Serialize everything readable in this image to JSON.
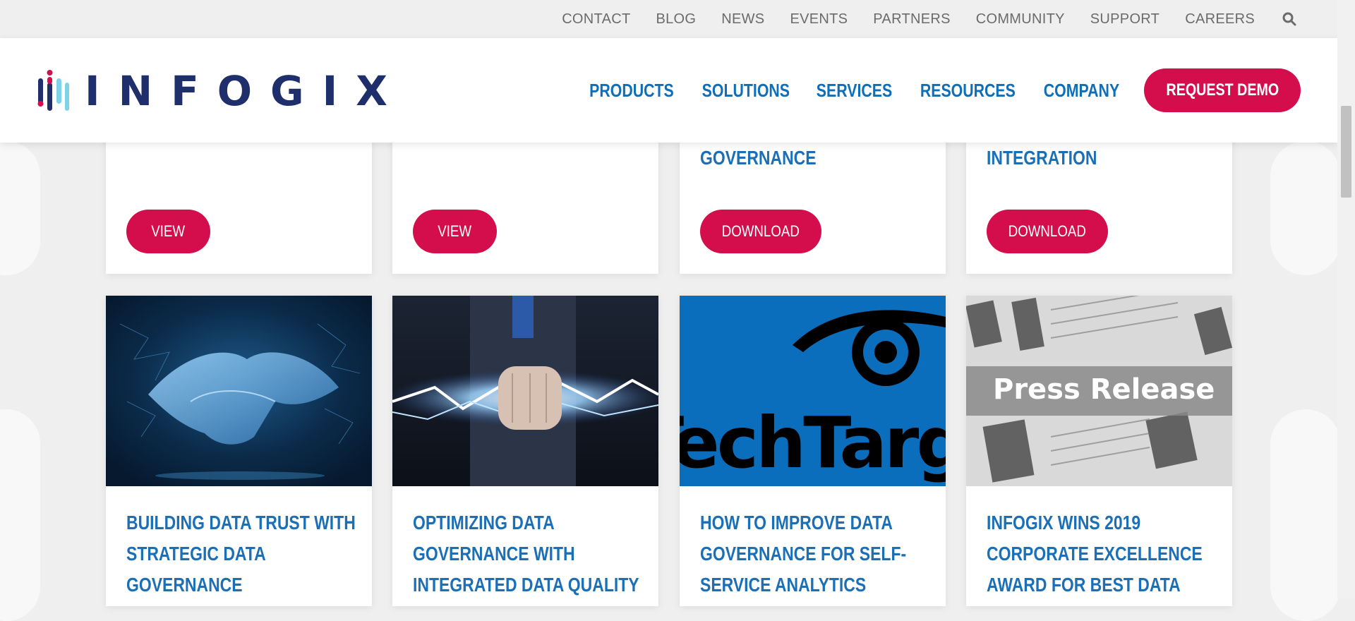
{
  "topbar": {
    "links": [
      "CONTACT",
      "BLOG",
      "NEWS",
      "EVENTS",
      "PARTNERS",
      "COMMUNITY",
      "SUPPORT",
      "CAREERS"
    ],
    "search_icon": "search-icon"
  },
  "header": {
    "logo_text": "INFOGIX",
    "nav": [
      "PRODUCTS",
      "SOLUTIONS",
      "SERVICES",
      "RESOURCES",
      "COMPANY"
    ],
    "cta_label": "REQUEST DEMO"
  },
  "colors": {
    "brand_blue": "#1a6fb7",
    "brand_navy": "#1f2f6b",
    "accent_red": "#d40e4d",
    "logo_cyan": "#7fd3e8"
  },
  "cards_top": [
    {
      "title": "",
      "button": "VIEW"
    },
    {
      "title": "",
      "button": "VIEW"
    },
    {
      "title": "GOVERNANCE",
      "button": "DOWNLOAD"
    },
    {
      "title": "INTEGRATION",
      "button": "DOWNLOAD"
    }
  ],
  "cards_bottom": [
    {
      "image": "handshake-image",
      "title_lines": [
        "BUILDING DATA TRUST WITH",
        "STRATEGIC DATA",
        "GOVERNANCE"
      ]
    },
    {
      "image": "lightning-fist-image",
      "title_lines": [
        "OPTIMIZING DATA",
        "GOVERNANCE WITH",
        "INTEGRATED DATA QUALITY"
      ]
    },
    {
      "image": "techtarget-logo-image",
      "image_text": "TechTarget",
      "title_lines": [
        "HOW TO IMPROVE DATA",
        "GOVERNANCE FOR SELF-",
        "SERVICE ANALYTICS"
      ]
    },
    {
      "image": "press-release-image",
      "image_text": "Press Release",
      "title_lines": [
        "INFOGIX WINS 2019",
        "CORPORATE EXCELLENCE",
        "AWARD FOR BEST DATA"
      ]
    }
  ]
}
